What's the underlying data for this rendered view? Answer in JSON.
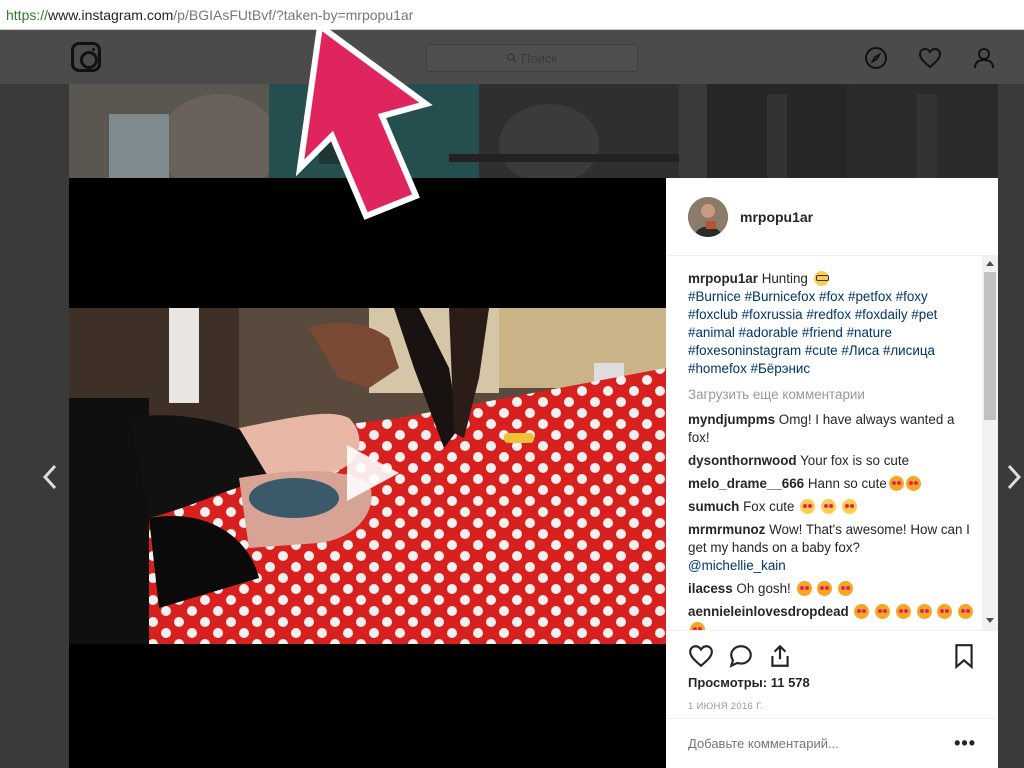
{
  "browser": {
    "url_scheme": "https://",
    "url_domain": "www.instagram.com",
    "url_path": "/p/BGIAsFUtBvf/?taken-by=mrpopu1ar"
  },
  "header": {
    "search_placeholder": "Поиск",
    "icons": [
      "instagram-logo-icon",
      "compass-icon",
      "heart-icon",
      "profile-icon"
    ]
  },
  "post": {
    "username": "mrpopu1ar",
    "caption_user": "mrpopu1ar",
    "caption_text": "Hunting",
    "hashtags_line1": "#Burnice #Burnicefox #fox #petfox #foxy",
    "hashtags_line2": "#foxclub #foxrussia #redfox #foxdaily #pet",
    "hashtags_line3": "#animal #adorable #friend #nature",
    "hashtags_line4": "#foxesoninstagram #cute #Лиса #лисица",
    "hashtags_line5": "#homefox #Бёрэнис",
    "load_more": "Загрузить еще комментарии",
    "comments": [
      {
        "user": "myndjumpms",
        "text": "Omg! I have always wanted a fox!"
      },
      {
        "user": "dysonthornwood",
        "text": "Your fox is so cute"
      },
      {
        "user": "melo_drame__666",
        "text": "Hann so cute"
      },
      {
        "user": "sumuch",
        "text": "Fox cute"
      },
      {
        "user": "mrmrmunoz",
        "text": "Wow! That's awesome! How can I get my hands on a baby fox?",
        "mention": "@michellie_kain"
      },
      {
        "user": "ilacess",
        "text": "Oh gosh!"
      },
      {
        "user": "aennieleinlovesdropdead",
        "text": ""
      }
    ],
    "views_label": "Просмотры:",
    "views_count": "11 578",
    "date": "1 ИЮНЯ 2016 Г.",
    "add_comment_placeholder": "Добавьте комментарий...",
    "more_options": "•••"
  },
  "colors": {
    "accent_arrow": "#e0245e",
    "link": "#003569",
    "video_bed": "#d8201f"
  }
}
